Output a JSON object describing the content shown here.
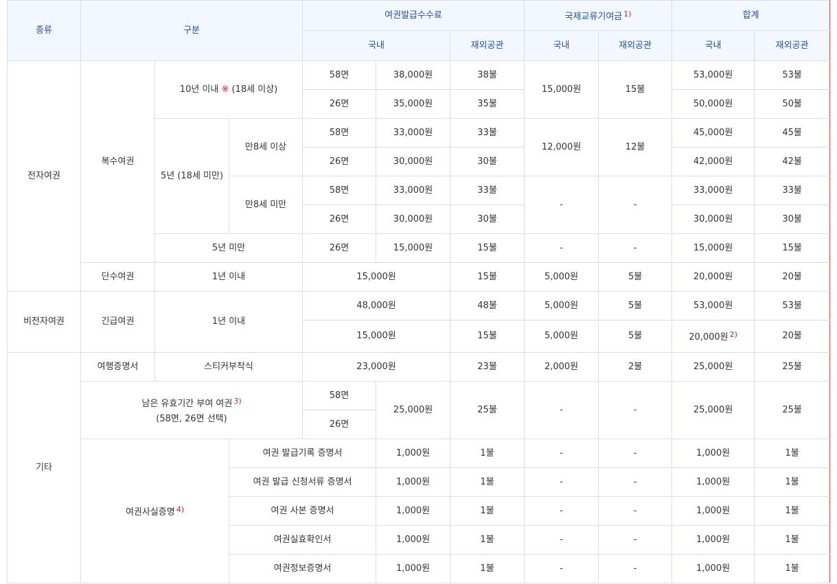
{
  "header": {
    "kind": "종류",
    "category": "구분",
    "issue_fee": "여권발급수수료",
    "intl_fund": "국제교류기여금",
    "intl_fund_note": "1)",
    "total": "합계",
    "domestic": "국내",
    "overseas": "재외공관"
  },
  "electronic": {
    "kind": "전자여권",
    "multiple": {
      "label": "복수여권",
      "ten_year": {
        "label_a": "10년 이내 ",
        "mark": "※",
        "label_b": " (18세 이상)",
        "rows": [
          {
            "pages": "58면",
            "dom": "38,000원",
            "ovs": "38불",
            "total_dom": "53,000원",
            "total_ovs": "53불"
          },
          {
            "pages": "26면",
            "dom": "35,000원",
            "ovs": "35불",
            "total_dom": "50,000원",
            "total_ovs": "50불"
          }
        ],
        "fund_dom": "15,000원",
        "fund_ovs": "15불"
      },
      "five_year": {
        "label": "5년 (18세 미만)",
        "age8_over": {
          "label": "만8세 이상",
          "rows": [
            {
              "pages": "58면",
              "dom": "33,000원",
              "ovs": "33불",
              "total_dom": "45,000원",
              "total_ovs": "45불"
            },
            {
              "pages": "26면",
              "dom": "30,000원",
              "ovs": "30불",
              "total_dom": "42,000원",
              "total_ovs": "42불"
            }
          ],
          "fund_dom": "12,000원",
          "fund_ovs": "12불"
        },
        "age8_under": {
          "label": "만8세 미만",
          "rows": [
            {
              "pages": "58면",
              "dom": "33,000원",
              "ovs": "33불",
              "total_dom": "33,000원",
              "total_ovs": "33불"
            },
            {
              "pages": "26면",
              "dom": "30,000원",
              "ovs": "30불",
              "total_dom": "30,000원",
              "total_ovs": "30불"
            }
          ],
          "fund_dom": "-",
          "fund_ovs": "-"
        }
      },
      "under_five": {
        "label": "5년 미만",
        "pages": "26면",
        "dom": "15,000원",
        "ovs": "15불",
        "fund_dom": "-",
        "fund_ovs": "-",
        "total_dom": "15,000원",
        "total_ovs": "15불"
      }
    },
    "single": {
      "label": "단수여권",
      "period": "1년 이내",
      "dom": "15,000원",
      "ovs": "15불",
      "fund_dom": "5,000원",
      "fund_ovs": "5불",
      "total_dom": "20,000원",
      "total_ovs": "20불"
    }
  },
  "non_electronic": {
    "kind": "비전자여권",
    "label": "긴급여권",
    "period": "1년 이내",
    "rows": [
      {
        "dom": "48,000원",
        "ovs": "48불",
        "fund_dom": "5,000원",
        "fund_ovs": "5불",
        "total_dom": "53,000원",
        "total_ovs": "53불",
        "note": ""
      },
      {
        "dom": "15,000원",
        "ovs": "15불",
        "fund_dom": "5,000원",
        "fund_ovs": "5불",
        "total_dom": "20,000원",
        "total_ovs": "20불",
        "note": "2)"
      }
    ]
  },
  "other": {
    "kind": "기타",
    "travel_cert": {
      "label": "여행증명서",
      "type": "스티커부착식",
      "dom": "23,000원",
      "ovs": "23불",
      "fund_dom": "2,000원",
      "fund_ovs": "2불",
      "total_dom": "25,000원",
      "total_ovs": "25불"
    },
    "remaining": {
      "label_a": "남은 유효기간 부여 여권",
      "note": "3)",
      "label_b": "(58면, 26면 선택)",
      "pages_a": "58면",
      "pages_b": "26면",
      "dom": "25,000원",
      "ovs": "25불",
      "fund_dom": "-",
      "fund_ovs": "-",
      "total_dom": "25,000원",
      "total_ovs": "25불"
    },
    "fact_cert": {
      "label": "여권사실증명",
      "note": "4)",
      "rows": [
        {
          "name": "여권 발급기록 증명서",
          "dom": "1,000원",
          "ovs": "1불",
          "fund_dom": "-",
          "fund_ovs": "-",
          "total_dom": "1,000원",
          "total_ovs": "1불"
        },
        {
          "name": "여권 발급 신청서류 증명서",
          "dom": "1,000원",
          "ovs": "1불",
          "fund_dom": "-",
          "fund_ovs": "-",
          "total_dom": "1,000원",
          "total_ovs": "1불"
        },
        {
          "name": "여권 사본 증명서",
          "dom": "1,000원",
          "ovs": "1불",
          "fund_dom": "-",
          "fund_ovs": "-",
          "total_dom": "1,000원",
          "total_ovs": "1불"
        },
        {
          "name": "여권실효확인서",
          "dom": "1,000원",
          "ovs": "1불",
          "fund_dom": "-",
          "fund_ovs": "-",
          "total_dom": "1,000원",
          "total_ovs": "1불"
        },
        {
          "name": "여권정보증명서",
          "dom": "1,000원",
          "ovs": "1불",
          "fund_dom": "-",
          "fund_ovs": "-",
          "total_dom": "1,000원",
          "total_ovs": "1불"
        }
      ]
    }
  }
}
